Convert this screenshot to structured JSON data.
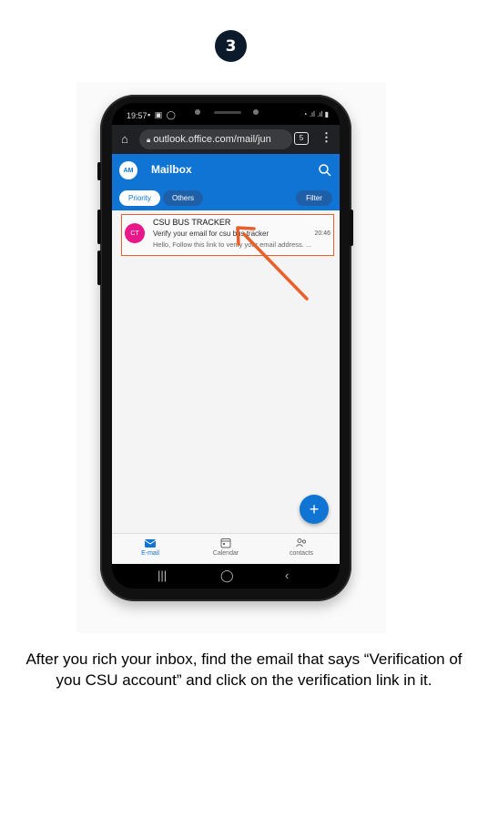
{
  "step": {
    "number": "3"
  },
  "phone_status": {
    "time": "19:57"
  },
  "browser": {
    "url": "outlook.office.com/mail/jun",
    "tabs_count": "5"
  },
  "mailbox": {
    "avatar_initials": "AM",
    "title": "Mailbox",
    "tabs": {
      "priority": "Priority",
      "others": "Others"
    },
    "filter_label": "Filter"
  },
  "email": {
    "avatar_initials": "CT",
    "sender": "CSU BUS TRACKER",
    "subject": "Verify your email for csu bus tracker",
    "time": "20:46",
    "preview": "Hello, Follow this link to verify your email address. ..."
  },
  "bottom_nav": {
    "email": "E-mail",
    "calendar": "Calendar",
    "contacts": "contacts"
  },
  "fab_icon": "+",
  "colors": {
    "accent": "#0f74d4",
    "highlight": "#e9602a",
    "avatar_ct": "#e8188b"
  },
  "caption": "After you rich your inbox, find the email that says “Verification of you CSU account” and click on the verification link in it."
}
